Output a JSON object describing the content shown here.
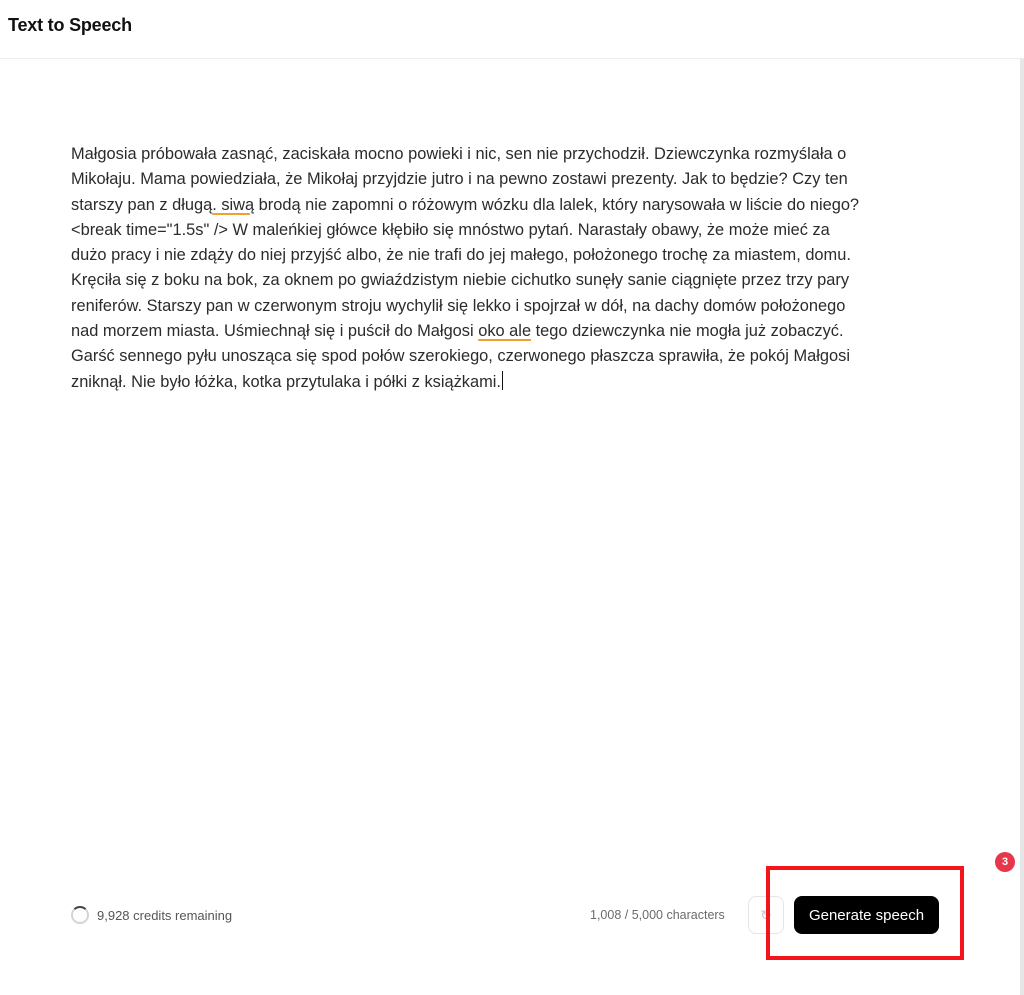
{
  "header": {
    "title": "Text to Speech"
  },
  "editor": {
    "lines": [
      {
        "pre": "Małgosia próbowała zasnąć, zaciskała mocno powieki i nic, sen nie przychodził. Dziewczynka rozmyślała o",
        "mark": "",
        "post": ""
      },
      {
        "pre": "Mikołaju. Mama powiedziała, że Mikołaj przyjdzie jutro i na pewno zostawi  prezenty. Jak to będzie? Czy ten",
        "mark": "",
        "post": ""
      },
      {
        "pre": "starszy pan z długą",
        "mark": ". siwą",
        "post": " brodą nie zapomni o różowym wózku dla lalek, który narysowała w liście do niego?"
      },
      {
        "pre": "<break time=\"1.5s\" /> W maleńkiej główce kłębiło się mnóstwo pytań. Narastały obawy, że może mieć za",
        "mark": "",
        "post": ""
      },
      {
        "pre": "dużo pracy i nie zdąży do niej przyjść albo, że nie trafi do jej małego, położonego trochę za miastem, domu.",
        "mark": "",
        "post": ""
      },
      {
        "pre": "Kręciła się z boku na bok, za oknem po gwiaździstym niebie cichutko sunęły sanie ciągnięte przez trzy pary",
        "mark": "",
        "post": ""
      },
      {
        "pre": "reniferów. Starszy pan w czerwonym stroju wychylił się lekko i spojrzał w dół, na dachy domów położonego",
        "mark": "",
        "post": ""
      },
      {
        "pre": "nad morzem miasta. Uśmiechnął się i puścił do Małgosi ",
        "mark": "oko ale",
        "post": " tego dziewczynka nie mogła już zobaczyć."
      },
      {
        "pre": "Garść sennego pyłu unosząca się spod połów szerokiego, czerwonego płaszcza sprawiła, że pokój Małgosi",
        "mark": "",
        "post": ""
      },
      {
        "pre": "zniknął. Nie było łóżka, kotka przytulaka i półki z książkami.",
        "mark": "",
        "post": ""
      }
    ]
  },
  "footer": {
    "credits": "9,928 credits remaining",
    "char_count": "1,008 / 5,000 characters",
    "generate_label": "Generate speech",
    "history_icon": "refresh-icon"
  },
  "notification": {
    "count": "3"
  },
  "colors": {
    "highlight": "#f5141a",
    "badge": "#e8364a",
    "spell_underline": "#f0a030",
    "button_bg": "#000000"
  }
}
